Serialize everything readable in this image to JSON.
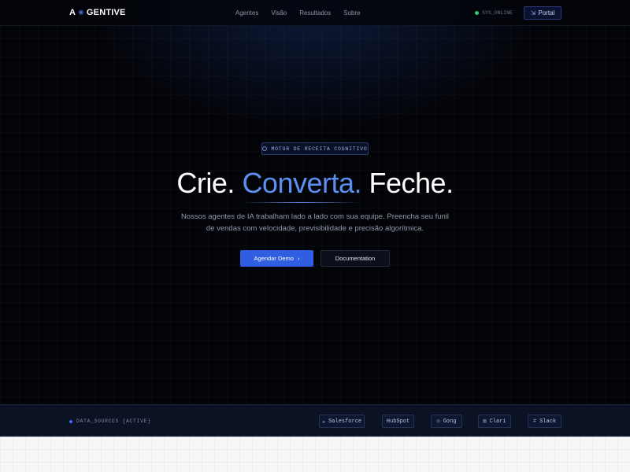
{
  "nav": {
    "brand_prefix": "A",
    "brand_icon": "spark-icon",
    "brand_name": "GENTIVE",
    "links": [
      "Agentes",
      "Visão",
      "Resultados",
      "Sobre"
    ],
    "status_text": "SYS_ONLINE",
    "portal_label": "Portal"
  },
  "hero": {
    "badge": "MOTOR DE RECEITA COGNITIVO",
    "headline_start": "Crie. ",
    "headline_accent": "Converta.",
    "headline_end": " Feche.",
    "subtitle_line1": "Nossos agentes de IA trabalham lado a lado com sua equipe. Preencha seu funil",
    "subtitle_line2": "de vendas com velocidade, previsibilidade e precisão algorítmica.",
    "primary_cta": "Agendar Demo",
    "primary_cta_arrow": "›",
    "secondary_cta": "Documentation"
  },
  "sources": {
    "label": "DATA_SOURCES [ACTIVE]",
    "items": [
      {
        "name": "Salesforce",
        "icon": "cloud-icon",
        "glyph": "☁"
      },
      {
        "name": "HubSpot",
        "icon": "",
        "glyph": ""
      },
      {
        "name": "Gong",
        "icon": "gong-icon",
        "glyph": "◎"
      },
      {
        "name": "Clari",
        "icon": "chart-icon",
        "glyph": "▥"
      },
      {
        "name": "Slack",
        "icon": "hash-icon",
        "glyph": "#"
      }
    ]
  },
  "colors": {
    "accent": "#5d8ff0",
    "primary_button": "#2f5fe0",
    "status_online": "#2ecc71"
  }
}
